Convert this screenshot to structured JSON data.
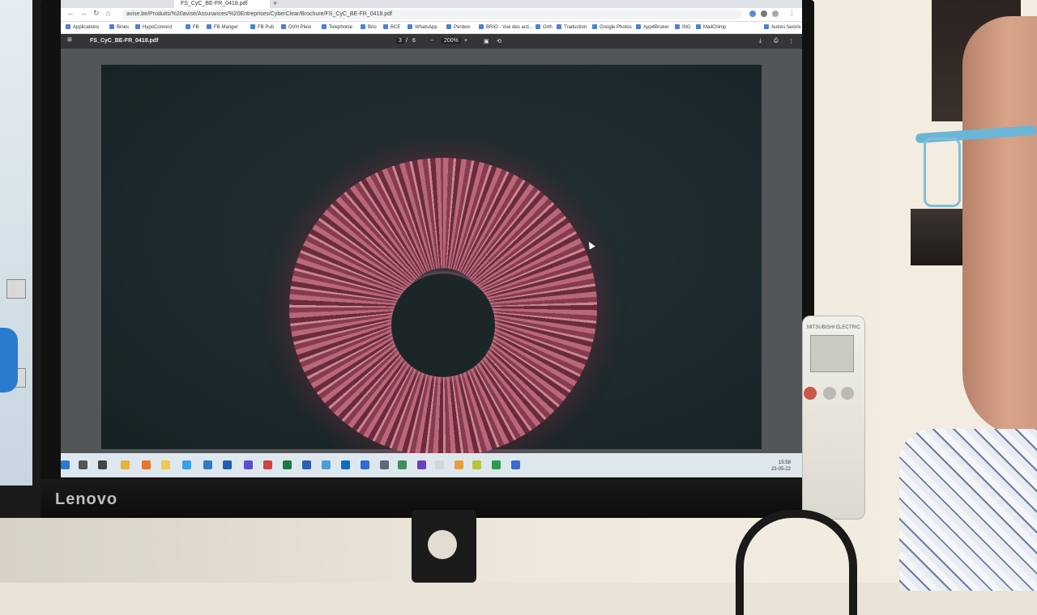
{
  "scene": {
    "monitor_brand": "Lenovo",
    "remote_brand": "MITSUBISHI ELECTRIC"
  },
  "browser": {
    "tab_title": "FS_CyC_BE-FR_0418.pdf",
    "url": "avise.be/Produits/%20avise/Assurances/%20Entreprises/CyberClear/Brochure/FS_CyC_BE-FR_0418.pdf",
    "bookmarks": [
      "Applications",
      "Bines",
      "HypoConnect",
      "FB",
      "FB Manger",
      "FB Pub",
      "OVH Pleio",
      "Telephonie",
      "Brio",
      "BCE",
      "WhatsApp",
      "Penbox",
      "BRIO - Vue des acti...",
      "Orth",
      "Traduction",
      "Google Photos",
      "App4Broker",
      "ING",
      "MailChimp",
      "Autres favoris"
    ]
  },
  "pdf": {
    "title": "FS_CyC_BE-FR_0418.pdf",
    "page_current": "3",
    "page_total": "6",
    "zoom": "200%"
  },
  "taskbar": {
    "time": "15:58",
    "date": "23-05-22"
  },
  "colors": {
    "iris": "#c26b80",
    "page_bg": "#1d292c",
    "glasses": "#6bb6d4"
  }
}
